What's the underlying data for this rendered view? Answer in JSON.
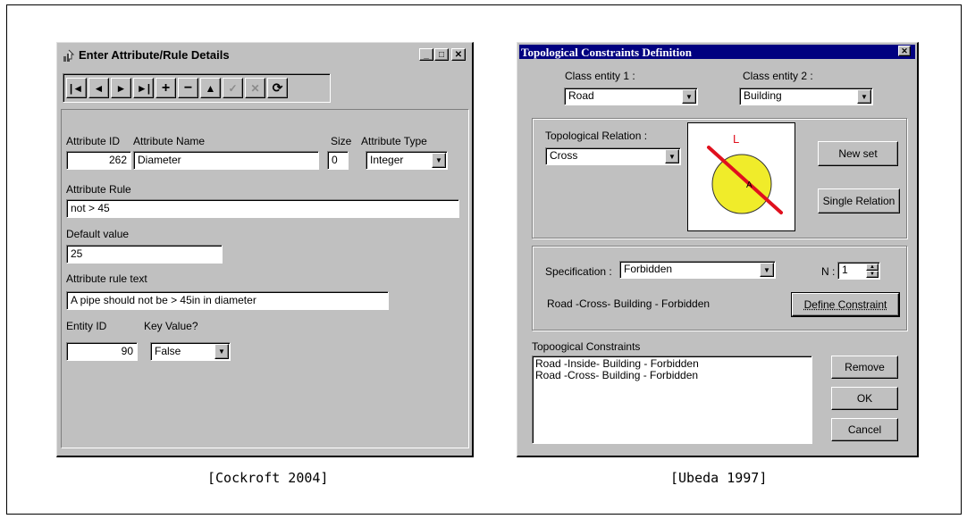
{
  "left_window": {
    "title": "Enter Attribute/Rule Details",
    "title_buttons": [
      "_",
      "□",
      "✕"
    ],
    "toolbar": [
      "|◄",
      "◄",
      "►",
      "►|",
      "+",
      "−",
      "▲",
      "✓",
      "✕",
      "⟳"
    ],
    "labels": {
      "attribute_id": "Attribute ID",
      "attribute_name": "Attribute Name",
      "size": "Size",
      "attribute_type": "Attribute Type",
      "attribute_rule": "Attribute Rule",
      "default_value": "Default value",
      "attribute_rule_text": "Attribute rule text",
      "entity_id": "Entity ID",
      "key_value": "Key Value?"
    },
    "values": {
      "attribute_id": "262",
      "attribute_name": "Diameter",
      "size": "0",
      "attribute_type": "Integer",
      "attribute_rule": "not > 45",
      "default_value": "25",
      "attribute_rule_text": "A pipe should not be > 45in in diameter",
      "entity_id": "90",
      "key_value": "False"
    }
  },
  "right_window": {
    "title": "Topological Constraints Definition",
    "close": "✕",
    "labels": {
      "class_entity_1": "Class entity 1 :",
      "class_entity_2": "Class entity 2 :",
      "topological_relation": "Topological Relation :",
      "specification": "Specification :",
      "n": "N :",
      "constraint_preview": "Road -Cross- Building - Forbidden",
      "constraints_list": "Topoogical Constraints"
    },
    "values": {
      "class_entity_1": "Road",
      "class_entity_2": "Building",
      "topological_relation": "Cross",
      "specification": "Forbidden",
      "n": "1"
    },
    "diagram": {
      "line_label": "L",
      "circle_label": "A",
      "circle_color": "#f0ec2a",
      "line_color": "#e0101e"
    },
    "buttons": {
      "new_set": "New set",
      "single_relation": "Single Relation",
      "define_constraint": "Define Constraint",
      "remove": "Remove",
      "ok": "OK",
      "cancel": "Cancel"
    },
    "constraints": [
      "Road -Inside- Building - Forbidden",
      "Road -Cross- Building - Forbidden"
    ]
  },
  "captions": {
    "left": "[Cockroft 2004]",
    "right": "[Ubeda 1997]"
  }
}
